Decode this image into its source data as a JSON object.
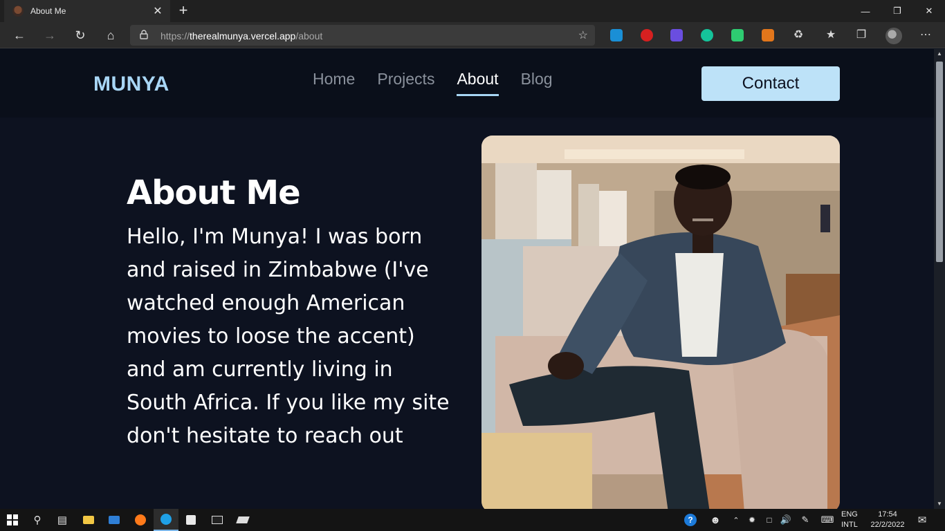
{
  "browser": {
    "tab_title": "About Me",
    "tab_close": "✕",
    "new_tab": "+",
    "url_scheme": "https://",
    "url_host": "therealmunya.vercel.app",
    "url_path": "/about"
  },
  "site": {
    "logo": "MUNYA",
    "nav": [
      "Home",
      "Projects",
      "About",
      "Blog"
    ],
    "active_nav": "About",
    "contact_label": "Contact",
    "heading": "About Me",
    "intro": "Hello, I'm Munya! I was born and raised in Zimbabwe (I've watched enough American movies to loose the accent) and am currently living in South Africa. If you like my site don't hesitate to reach out"
  },
  "taskbar": {
    "language_line1": "ENG",
    "language_line2": "INTL",
    "time": "17:54",
    "date": "22/2/2022"
  },
  "colors": {
    "accent": "#a8d6f5",
    "button": "#bde2f8",
    "page_bg": "#0d1220",
    "header_bg": "#0a0f1a"
  }
}
